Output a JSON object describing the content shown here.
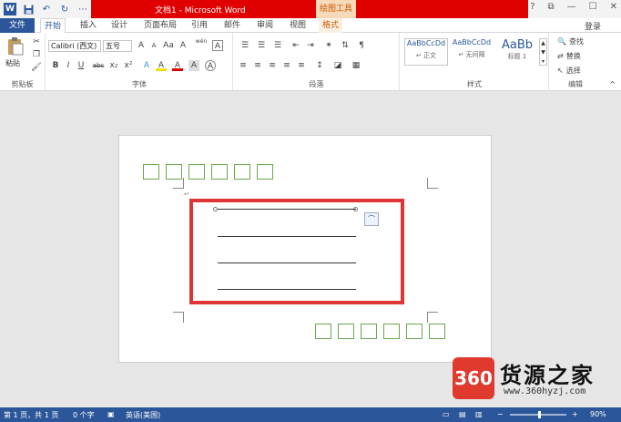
{
  "titlebar": {
    "doc_title": "文档1 - Microsoft Word",
    "drawing_tools": "绘图工具",
    "word_logo": "W",
    "qat_sep": "⋯",
    "help": "?",
    "restore": "⧉",
    "minimize": "—",
    "maximize": "☐",
    "close": "✕"
  },
  "tabs": {
    "file": "文件",
    "home": "开始",
    "insert": "插入",
    "design": "设计",
    "layout": "页面布局",
    "references": "引用",
    "mailings": "邮件",
    "review": "审阅",
    "view": "视图",
    "format": "格式",
    "login": "登录"
  },
  "ribbon": {
    "clipboard": {
      "paste": "粘贴",
      "label": "剪贴板"
    },
    "font": {
      "font_name": "Calibri (西文)",
      "font_size": "五号",
      "wen": "wén",
      "label": "字体",
      "bold": "B",
      "italic": "I",
      "underline": "U",
      "strike": "abc",
      "sub": "x₂",
      "sup": "x²",
      "grow": "A",
      "shrink": "A",
      "case": "Aa",
      "clear": "A",
      "highlight": "A",
      "color": "A",
      "shade": "A",
      "border": "A"
    },
    "paragraph": {
      "label": "段落"
    },
    "styles": {
      "label": "样式",
      "items": [
        {
          "preview": "AaBbCcDd",
          "name": "↵ 正文"
        },
        {
          "preview": "AaBbCcDd",
          "name": "↵ 无间隔"
        },
        {
          "preview": "AaBb",
          "name": "标题 1"
        }
      ]
    },
    "editing": {
      "label": "编辑",
      "find": "查找",
      "replace": "替换",
      "select": "选择"
    }
  },
  "statusbar": {
    "page": "第 1 页，共 1 页",
    "words": "0 个字",
    "language": "英语(美国)",
    "zoom": "90%",
    "zoom_minus": "−",
    "zoom_plus": "+"
  },
  "watermark": {
    "logo": "360",
    "name": "货源之家",
    "url": "www.360hyzj.com"
  }
}
